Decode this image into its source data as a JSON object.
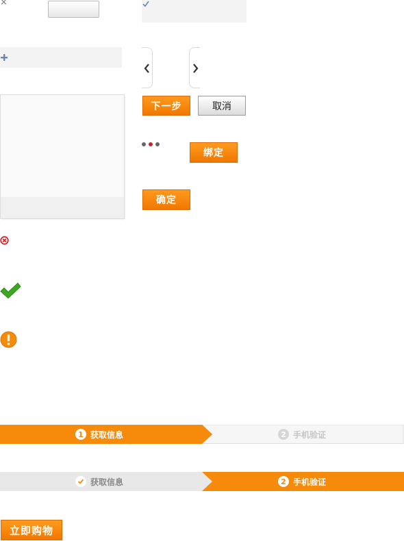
{
  "icons": {
    "close": "×",
    "check": "check-icon",
    "plus": "plus-icon",
    "arrow_left": "chevron-left-icon",
    "arrow_right": "chevron-right-icon",
    "error": "error-circle-icon",
    "success": "green-check-icon",
    "warning": "warning-circle-icon"
  },
  "buttons": {
    "next": "下一步",
    "cancel": "取消",
    "bind": "绑定",
    "confirm": "确定",
    "buy_now": "立即购物"
  },
  "pagination": {
    "dots": 3,
    "active_index": 1
  },
  "steps_bar_1": {
    "step1": {
      "num": "1",
      "label": "获取信息"
    },
    "step2": {
      "num": "2",
      "label": "手机验证"
    }
  },
  "steps_bar_2": {
    "step1": {
      "num": "✔",
      "label": "获取信息"
    },
    "step2": {
      "num": "2",
      "label": "手机验证"
    }
  },
  "colors": {
    "accent": "#f58a0b",
    "error": "#d8262a",
    "success": "#3ca821",
    "warning": "#f58a0b",
    "active_dot": "#c0282d"
  }
}
